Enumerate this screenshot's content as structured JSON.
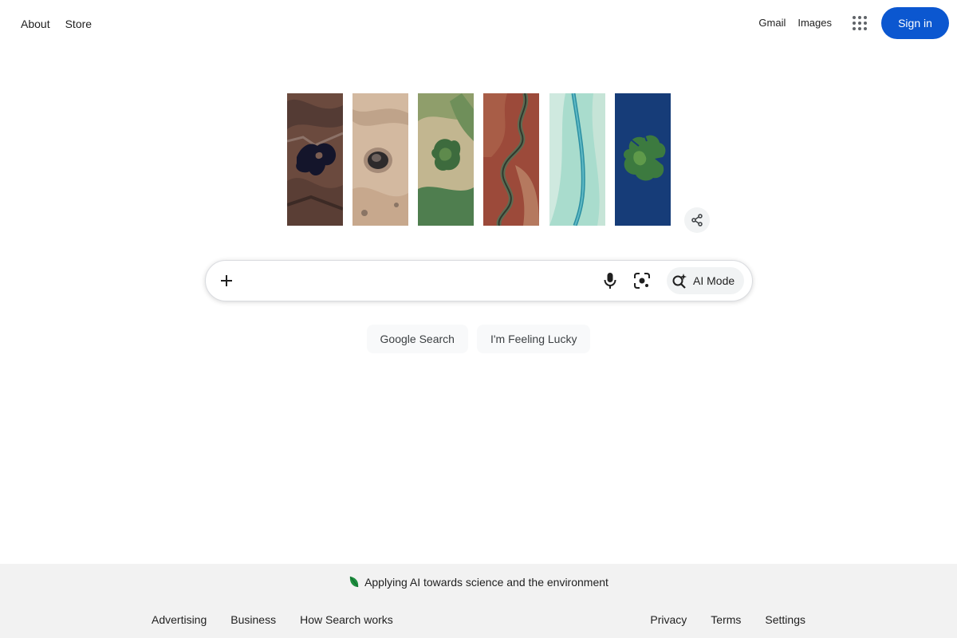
{
  "header": {
    "left_links": [
      "About",
      "Store"
    ],
    "gmail": "Gmail",
    "images": "Images",
    "apps_icon": "apps-grid-icon",
    "signin": "Sign in",
    "signin_color": "#0b57d0"
  },
  "doodle": {
    "panels": [
      "dark-lake-terrain",
      "crater-desert",
      "green-forest-patch",
      "winding-river-red",
      "turquoise-river",
      "blue-ocean-island"
    ],
    "share_icon": "share-icon"
  },
  "search": {
    "value": "",
    "placeholder": "",
    "plus_icon": "plus-icon",
    "mic_icon": "microphone-icon",
    "lens_icon": "lens-camera-icon",
    "ai_mode_icon": "ai-search-icon",
    "ai_mode_label": "AI Mode"
  },
  "buttons": {
    "search": "Google Search",
    "lucky": "I'm Feeling Lucky"
  },
  "footer": {
    "banner": "Applying AI towards science and the environment",
    "left_links": [
      "Advertising",
      "Business",
      "How Search works"
    ],
    "right_links": [
      "Privacy",
      "Terms",
      "Settings"
    ]
  }
}
